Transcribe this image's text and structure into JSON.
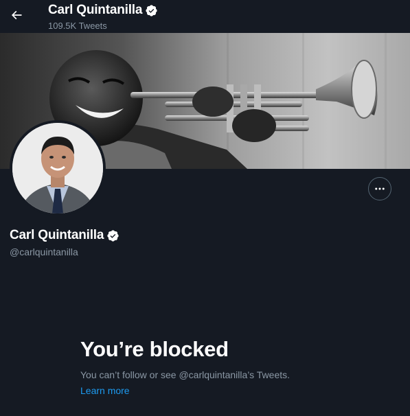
{
  "header": {
    "name": "Carl Quintanilla",
    "tweet_count": "109.5K Tweets",
    "back_icon": "arrow-left-icon",
    "verified_icon": "verified-badge-icon"
  },
  "banner": {
    "icon": "banner-photo"
  },
  "profile": {
    "name": "Carl Quintanilla",
    "handle": "@carlquintanilla",
    "more_icon": "more-horizontal-icon"
  },
  "blocked": {
    "title": "You’re blocked",
    "subtitle": "You can’t follow or see @carlquintanilla’s Tweets.",
    "link_text": "Learn more"
  },
  "colors": {
    "background": "#151a23",
    "secondary_text": "#8b98a5",
    "link": "#1d9bf0",
    "text": "#ffffff"
  }
}
